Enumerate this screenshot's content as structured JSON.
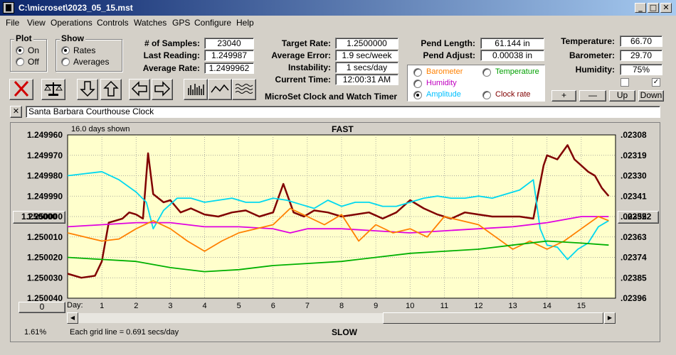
{
  "window": {
    "title": "C:\\microset\\2023_05_15.mst"
  },
  "menu": [
    "File",
    "View",
    "Operations",
    "Controls",
    "Watches",
    "GPS",
    "Configure",
    "Help"
  ],
  "plot_group": {
    "title": "Plot",
    "options": [
      "On",
      "Off"
    ],
    "selected": "On"
  },
  "show_group": {
    "title": "Show",
    "options": [
      "Rates",
      "Averages"
    ],
    "selected": "Rates"
  },
  "stats": {
    "samples_label": "# of Samples:",
    "samples": "23040",
    "last_reading_label": "Last Reading:",
    "last_reading": "1.249987",
    "average_rate_label": "Average Rate:",
    "average_rate": "1.2499962"
  },
  "rates": {
    "target_rate_label": "Target Rate:",
    "target_rate": "1.2500000",
    "average_error_label": "Average Error:",
    "average_error": "1.9 sec/week",
    "instability_label": "Instability:",
    "instability": "1 secs/day",
    "current_time_label": "Current Time:",
    "current_time": "12:00:31 AM"
  },
  "app_title": "MicroSet Clock and Watch Timer",
  "pendulum": {
    "length_label": "Pend Length:",
    "length": "61.144 in",
    "adjust_label": "Pend Adjust:",
    "adjust": "0.00038 in"
  },
  "environment": {
    "temperature_label": "Temperature:",
    "temperature": "66.70",
    "barometer_label": "Barometer:",
    "barometer": "29.70",
    "humidity_label": "Humidity:",
    "humidity": "75%"
  },
  "legend": {
    "items": [
      {
        "label": "Barometer",
        "color": "#ff8000",
        "selected": false
      },
      {
        "label": "Temperature",
        "color": "#00a000",
        "selected": false
      },
      {
        "label": "Humidity",
        "color": "#c000c0",
        "selected": false
      },
      {
        "label": "",
        "color": "",
        "selected": false
      },
      {
        "label": "Amplitude",
        "color": "#00c0ff",
        "selected": true
      },
      {
        "label": "Clock rate",
        "color": "#800000",
        "selected": false
      }
    ]
  },
  "adjust_buttons": [
    "+",
    "—",
    "Up",
    "Down"
  ],
  "checkboxes": [
    false,
    true
  ],
  "toolbar": {
    "icons": [
      "close-x-icon",
      "balance-scale-icon",
      "arrow-down-icon",
      "arrow-up-icon",
      "arrow-left-icon",
      "arrow-right-icon",
      "bar-graph-icon",
      "line-wave-icon",
      "multi-wave-icon"
    ]
  },
  "clock_name": {
    "close_label": "✕",
    "value": "Santa Barbara Courthouse Clock"
  },
  "chart_header": {
    "days_shown": "16.0 days shown",
    "fast_label": "FAST",
    "slow_label": "SLOW",
    "grid_note": "Each grid line = 0.691 secs/day",
    "percent": "1.61%",
    "day_label": "Day:",
    "center_left": "1.250000",
    "center_right": ".02352",
    "zero_button": "0"
  },
  "chart_data": {
    "type": "line",
    "x_range": [
      0,
      16
    ],
    "x_ticks": [
      "1",
      "2",
      "3",
      "4",
      "5",
      "6",
      "7",
      "8",
      "9",
      "10",
      "11",
      "12",
      "13",
      "14",
      "15"
    ],
    "y_left_ticks": [
      "1.249960",
      "1.249970",
      "1.249980",
      "1.249990",
      "1.250000",
      "1.250010",
      "1.250020",
      "1.250030",
      "1.250040"
    ],
    "y_right_ticks": [
      ".02308",
      ".02319",
      ".02330",
      ".02341",
      ".02352",
      ".02363",
      ".02374",
      ".02385",
      ".02396"
    ],
    "ylim": [
      1.25004,
      1.24996
    ],
    "grid": true,
    "series": [
      {
        "name": "Clock rate",
        "color": "#800000",
        "x": [
          0,
          0.4,
          0.8,
          1.0,
          1.2,
          1.4,
          1.6,
          1.8,
          2.0,
          2.2,
          2.35,
          2.5,
          2.8,
          3.0,
          3.3,
          3.6,
          4.0,
          4.4,
          4.8,
          5.2,
          5.6,
          6.0,
          6.3,
          6.6,
          6.9,
          7.2,
          7.6,
          8.0,
          8.4,
          8.8,
          9.2,
          9.6,
          10.0,
          10.4,
          10.8,
          11.2,
          11.6,
          12.0,
          12.4,
          12.8,
          13.2,
          13.6,
          13.9,
          14.0,
          14.3,
          14.6,
          14.8,
          15.0,
          15.2,
          15.4,
          15.6,
          15.8
        ],
        "y": [
          1.250028,
          1.25003,
          1.250029,
          1.250022,
          1.250003,
          1.250002,
          1.250001,
          1.249998,
          1.249999,
          1.250001,
          1.249969,
          1.249989,
          1.249993,
          1.249992,
          1.249998,
          1.249996,
          1.249999,
          1.25,
          1.249998,
          1.249997,
          1.25,
          1.249998,
          1.249984,
          1.249998,
          1.25,
          1.249997,
          1.249998,
          1.25,
          1.249999,
          1.249998,
          1.250001,
          1.249998,
          1.249992,
          1.249996,
          1.249999,
          1.250001,
          1.249998,
          1.249999,
          1.25,
          1.25,
          1.25,
          1.250001,
          1.249975,
          1.24997,
          1.249972,
          1.249965,
          1.249972,
          1.249975,
          1.249978,
          1.24998,
          1.249986,
          1.24999
        ]
      },
      {
        "name": "Amplitude",
        "color": "#00d8f0",
        "x": [
          0,
          0.5,
          1.0,
          1.5,
          2.0,
          2.3,
          2.5,
          2.8,
          3.2,
          3.6,
          4.0,
          4.4,
          4.8,
          5.2,
          5.6,
          6.0,
          6.4,
          6.8,
          7.2,
          7.6,
          8.0,
          8.4,
          8.8,
          9.2,
          9.6,
          10.0,
          10.4,
          10.8,
          11.2,
          11.6,
          12.0,
          12.4,
          12.8,
          13.2,
          13.6,
          13.8,
          14.0,
          14.3,
          14.6,
          14.9,
          15.2,
          15.5,
          15.8
        ],
        "y": [
          1.24998,
          1.249979,
          1.249978,
          1.249982,
          1.249988,
          1.249993,
          1.250006,
          1.249997,
          1.249991,
          1.249991,
          1.249993,
          1.249992,
          1.249991,
          1.249993,
          1.249993,
          1.249991,
          1.249992,
          1.249994,
          1.249996,
          1.249992,
          1.249995,
          1.249993,
          1.249993,
          1.249995,
          1.249995,
          1.249993,
          1.249991,
          1.24999,
          1.249991,
          1.249991,
          1.24999,
          1.249991,
          1.249989,
          1.249987,
          1.249982,
          1.250006,
          1.250014,
          1.250015,
          1.250021,
          1.250016,
          1.250013,
          1.250005,
          1.250002
        ]
      },
      {
        "name": "Humidity",
        "color": "#e000e0",
        "x": [
          0,
          1,
          2,
          3,
          4,
          5,
          6,
          6.5,
          7,
          8,
          9,
          10,
          11,
          12,
          13,
          14,
          15,
          15.8
        ],
        "y": [
          1.250005,
          1.250004,
          1.250003,
          1.250003,
          1.250005,
          1.250005,
          1.250006,
          1.250008,
          1.250006,
          1.250006,
          1.250007,
          1.250008,
          1.250007,
          1.250006,
          1.250005,
          1.250003,
          1.25,
          1.25
        ]
      },
      {
        "name": "Barometer",
        "color": "#ff8000",
        "x": [
          0,
          0.5,
          1.0,
          1.5,
          2.0,
          2.5,
          3.0,
          3.5,
          4.0,
          4.5,
          5.0,
          5.5,
          6.0,
          6.5,
          7.0,
          7.5,
          8.0,
          8.5,
          9.0,
          9.5,
          10.0,
          10.5,
          11.0,
          11.5,
          12.0,
          12.5,
          13.0,
          13.5,
          14.0,
          14.5,
          15.0,
          15.5,
          15.8
        ],
        "y": [
          1.250008,
          1.25001,
          1.250012,
          1.250011,
          1.250006,
          1.250002,
          1.250006,
          1.250012,
          1.250017,
          1.250012,
          1.250008,
          1.250006,
          1.250004,
          1.249996,
          1.25,
          1.250004,
          1.249999,
          1.250012,
          1.250004,
          1.250008,
          1.250006,
          1.25001,
          1.25,
          1.250002,
          1.250004,
          1.25001,
          1.250016,
          1.250012,
          1.250016,
          1.250012,
          1.250006,
          1.25,
          1.250002
        ]
      },
      {
        "name": "Temperature",
        "color": "#00b000",
        "x": [
          0,
          1,
          2,
          3,
          4,
          5,
          6,
          7,
          8,
          9,
          10,
          11,
          12,
          13,
          14,
          15,
          15.8
        ],
        "y": [
          1.25002,
          1.250021,
          1.250022,
          1.250025,
          1.250027,
          1.250026,
          1.250024,
          1.250023,
          1.250022,
          1.25002,
          1.250018,
          1.250017,
          1.250016,
          1.250014,
          1.250012,
          1.250013,
          1.250014
        ]
      }
    ]
  }
}
